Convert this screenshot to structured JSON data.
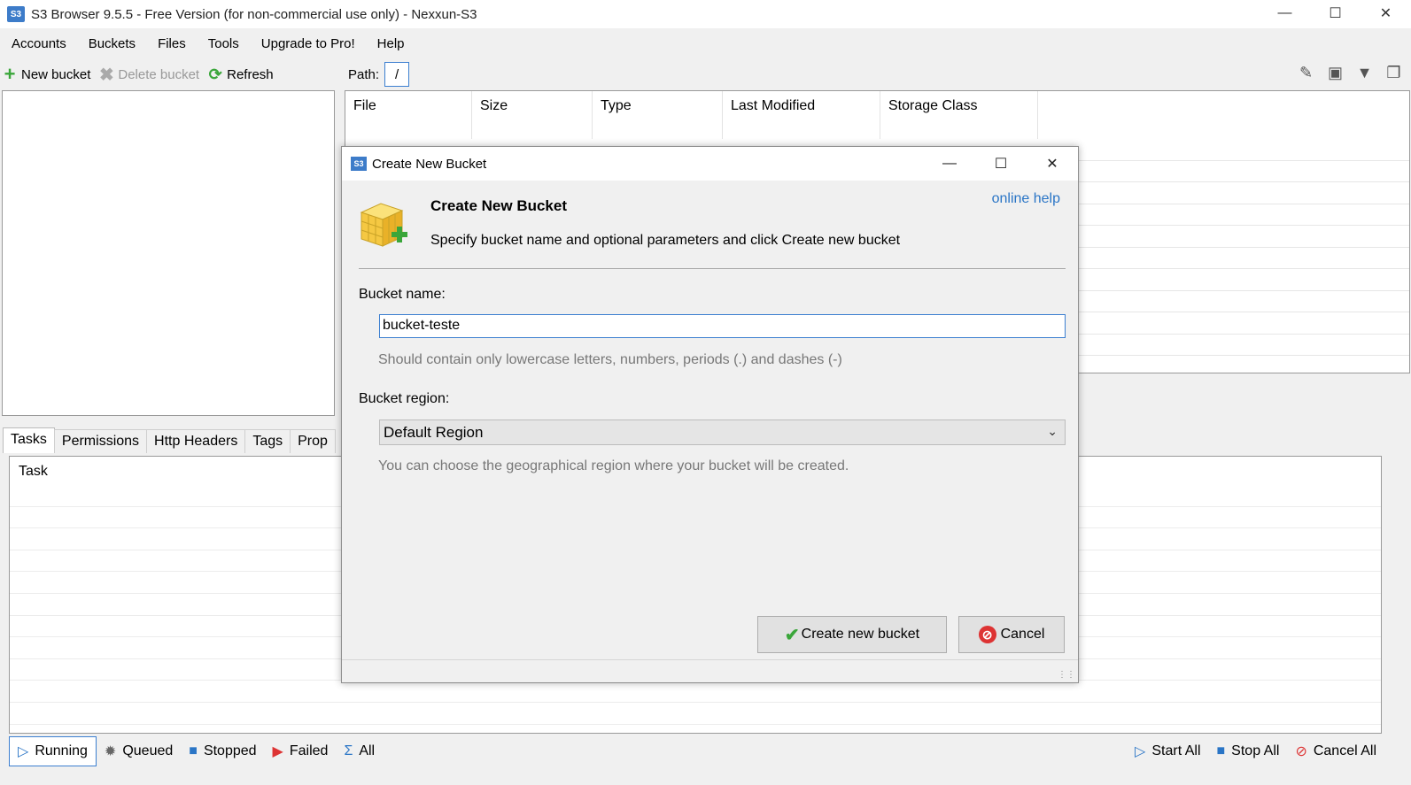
{
  "window": {
    "title": "S3 Browser 9.5.5 - Free Version (for non-commercial use only) - Nexxun-S3",
    "app_icon": "S3"
  },
  "menu": [
    "Accounts",
    "Buckets",
    "Files",
    "Tools",
    "Upgrade to Pro!",
    "Help"
  ],
  "toolbar": {
    "new_bucket": "New bucket",
    "delete_bucket": "Delete bucket",
    "refresh": "Refresh"
  },
  "path": {
    "label": "Path:",
    "value": "/"
  },
  "file_columns": [
    "File",
    "Size",
    "Type",
    "Last Modified",
    "Storage Class"
  ],
  "tabs": [
    "Tasks",
    "Permissions",
    "Http Headers",
    "Tags",
    "Prop"
  ],
  "tasks": {
    "column": "Task"
  },
  "status": {
    "running": "Running",
    "queued": "Queued",
    "stopped": "Stopped",
    "failed": "Failed",
    "all": "All",
    "start_all": "Start All",
    "stop_all": "Stop All",
    "cancel_all": "Cancel All"
  },
  "dialog": {
    "title": "Create New Bucket",
    "heading": "Create New Bucket",
    "subtitle": "Specify bucket name and optional parameters and click Create new bucket",
    "online_help": "online help",
    "name_label": "Bucket name:",
    "name_value": "bucket-teste",
    "name_hint": "Should contain only lowercase letters, numbers, periods (.) and dashes (-)",
    "region_label": "Bucket region:",
    "region_value": "Default Region",
    "region_hint": "You can choose the geographical region where your bucket will be created.",
    "create_button": "Create new bucket",
    "cancel_button": "Cancel"
  },
  "colors": {
    "accent": "#3c7fd0",
    "link": "#2a75c6",
    "success": "#3aa63a",
    "danger": "#d33333"
  }
}
